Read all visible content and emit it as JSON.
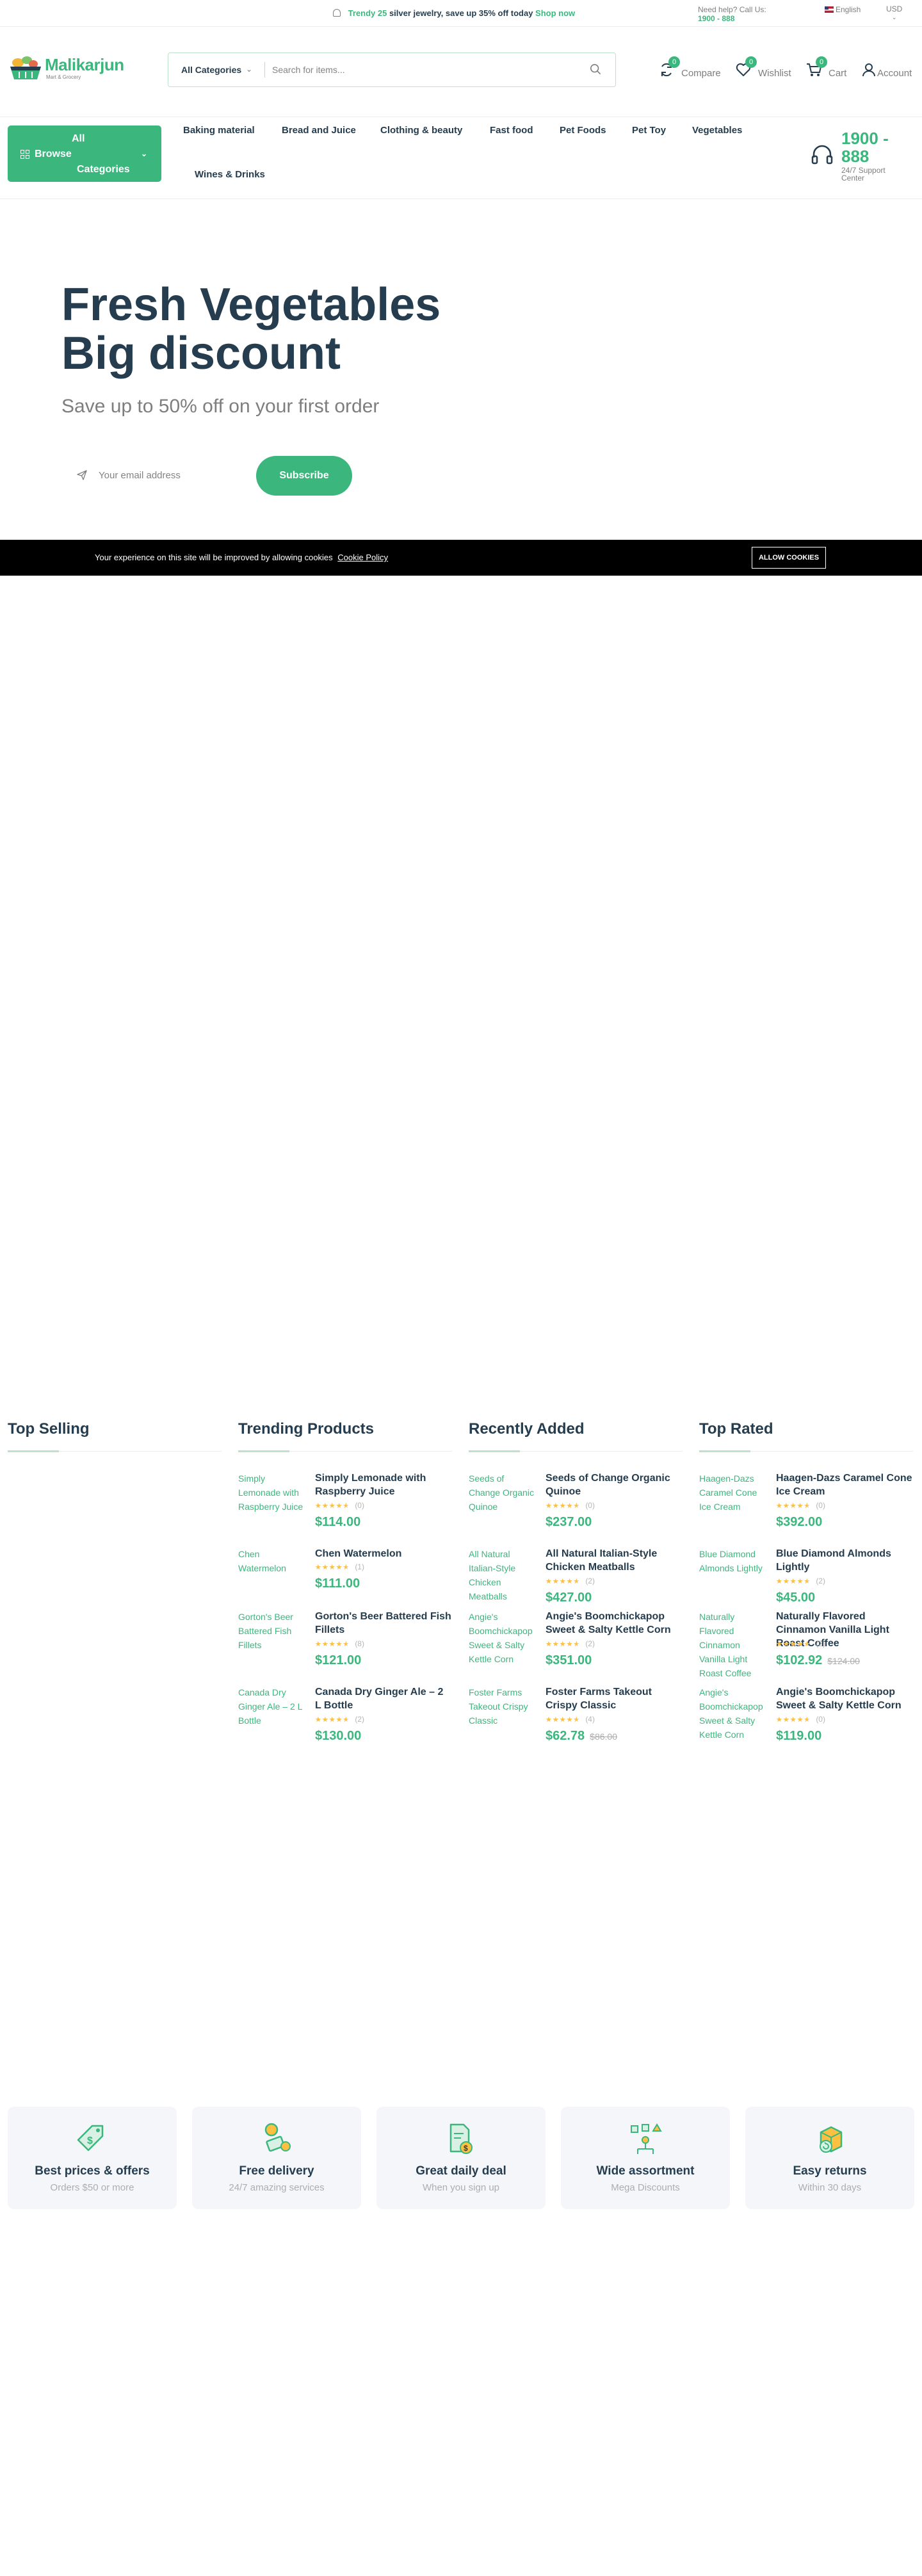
{
  "topbar": {
    "promo_prefix": "Trendy 25",
    "promo_middle": "silver jewelry, save up 35% off today",
    "promo_link": "Shop now",
    "help_text": "Need help? Call Us:",
    "help_phone": "1900 - 888",
    "language": "English",
    "currency": "USD"
  },
  "header": {
    "logo_name": "Malikarjun",
    "logo_tagline": "Mart & Grocery",
    "search_category": "All Categories",
    "search_placeholder": "Search for items...",
    "compare_label": "Compare",
    "compare_count": "0",
    "wishlist_label": "Wishlist",
    "wishlist_count": "0",
    "cart_label": "Cart",
    "cart_count": "0",
    "account_label": "Account"
  },
  "nav": {
    "browse_line1": "All",
    "browse_line2": "Browse",
    "browse_line3": "Categories",
    "items": [
      "Baking material",
      "Bread and Juice",
      "Clothing & beauty",
      "Fast food",
      "Pet Foods",
      "Pet Toy",
      "Vegetables",
      "Wines & Drinks"
    ],
    "support_number": "1900 - 888",
    "support_label": "24/7 Support Center"
  },
  "hero": {
    "title_line1": "Fresh Vegetables",
    "title_line2": "Big discount",
    "subtitle": "Save up to 50% off on your first order",
    "email_placeholder": "Your email address",
    "subscribe_label": "Subscribe"
  },
  "cookie": {
    "text": "Your experience on this site will be improved by allowing cookies",
    "policy_link": "Cookie Policy",
    "allow_label": "ALLOW COOKIES"
  },
  "columns": [
    {
      "title": "Top Selling",
      "products": []
    },
    {
      "title": "Trending Products",
      "products": [
        {
          "img_alt": "Simply Lemonade with Raspberry Juice",
          "name": "Simply Lemonade with Raspberry Juice",
          "rating": 0.9,
          "reviews": "(0)",
          "price": "$114.00",
          "old_price": ""
        },
        {
          "img_alt": "Chen Watermelon",
          "name": "Chen Watermelon",
          "rating": 0.9,
          "reviews": "(1)",
          "price": "$111.00",
          "old_price": ""
        },
        {
          "img_alt": "Gorton's Beer Battered Fish Fillets",
          "name": "Gorton's Beer Battered Fish Fillets",
          "rating": 0.9,
          "reviews": "(8)",
          "price": "$121.00",
          "old_price": ""
        },
        {
          "img_alt": "Canada Dry Ginger Ale – 2 L Bottle",
          "name": "Canada Dry Ginger Ale – 2 L Bottle",
          "rating": 0.9,
          "reviews": "(2)",
          "price": "$130.00",
          "old_price": ""
        }
      ]
    },
    {
      "title": "Recently Added",
      "products": [
        {
          "img_alt": "Seeds of Change Organic Quinoe",
          "name": "Seeds of Change Organic Quinoe",
          "rating": 0.9,
          "reviews": "(0)",
          "price": "$237.00",
          "old_price": ""
        },
        {
          "img_alt": "All Natural Italian-Style Chicken Meatballs",
          "name": "All Natural Italian-Style Chicken Meatballs",
          "rating": 0.9,
          "reviews": "(2)",
          "price": "$427.00",
          "old_price": ""
        },
        {
          "img_alt": "Angie's Boomchickapop Sweet & Salty Kettle Corn",
          "name": "Angie's Boomchickapop Sweet & Salty Kettle Corn",
          "rating": 0.9,
          "reviews": "(2)",
          "price": "$351.00",
          "old_price": ""
        },
        {
          "img_alt": "Foster Farms Takeout Crispy Classic",
          "name": "Foster Farms Takeout Crispy Classic",
          "rating": 0.9,
          "reviews": "(4)",
          "price": "$62.78",
          "old_price": "$86.00"
        }
      ]
    },
    {
      "title": "Top Rated",
      "products": [
        {
          "img_alt": "Haagen-Dazs Caramel Cone Ice Cream",
          "name": "Haagen-Dazs Caramel Cone Ice Cream",
          "rating": 0.9,
          "reviews": "(0)",
          "price": "$392.00",
          "old_price": ""
        },
        {
          "img_alt": "Blue Diamond Almonds Lightly",
          "name": "Blue Diamond Almonds Lightly",
          "rating": 0.9,
          "reviews": "(2)",
          "price": "$45.00",
          "old_price": ""
        },
        {
          "img_alt": "Naturally Flavored Cinnamon Vanilla Light Roast Coffee",
          "name": "Naturally Flavored Cinnamon Vanilla Light Roast Coffee",
          "rating": 0.9,
          "reviews": "(2)",
          "price": "$102.92",
          "old_price": "$124.00"
        },
        {
          "img_alt": "Angie's Boomchickapop Sweet & Salty Kettle Corn",
          "name": "Angie's Boomchickapop Sweet & Salty Kettle Corn",
          "rating": 0.9,
          "reviews": "(0)",
          "price": "$119.00",
          "old_price": ""
        }
      ]
    }
  ],
  "features": [
    {
      "icon": "price-tag-icon",
      "title": "Best prices & offers",
      "subtitle": "Orders $50 or more"
    },
    {
      "icon": "delivery-icon",
      "title": "Free delivery",
      "subtitle": "24/7 amazing services"
    },
    {
      "icon": "daily-deal-icon",
      "title": "Great daily deal",
      "subtitle": "When you sign up"
    },
    {
      "icon": "assortment-icon",
      "title": "Wide assortment",
      "subtitle": "Mega Discounts"
    },
    {
      "icon": "returns-icon",
      "title": "Easy returns",
      "subtitle": "Within 30 days"
    }
  ],
  "colors": {
    "brand": "#3bb77e",
    "heading": "#253d4e",
    "muted": "#7e7e7e",
    "star": "#fdc040"
  }
}
